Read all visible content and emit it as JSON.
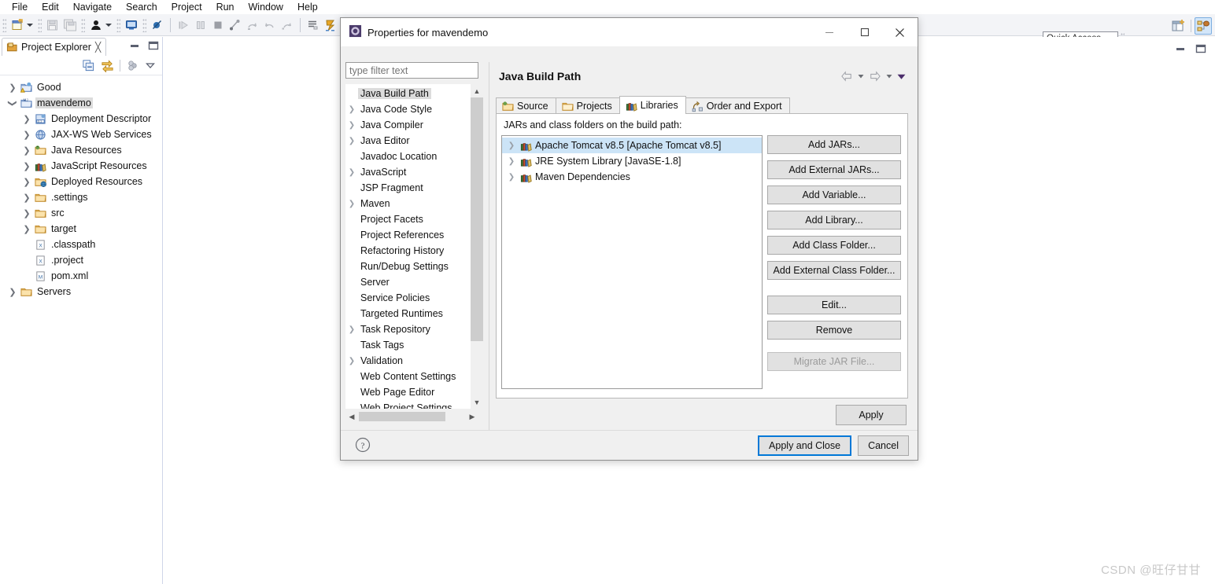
{
  "app": {
    "menubar": [
      "File",
      "Edit",
      "Navigate",
      "Search",
      "Project",
      "Run",
      "Window",
      "Help"
    ],
    "quick_access_placeholder": "Quick Access"
  },
  "explorer": {
    "tab_label": "Project Explorer",
    "tree": [
      {
        "label": "Good",
        "indent": 0,
        "twisty": "collapsed",
        "icon": "java-project-warning-icon",
        "selected": false
      },
      {
        "label": "mavendemo",
        "indent": 0,
        "twisty": "expanded",
        "icon": "maven-project-icon",
        "selected": true
      },
      {
        "label": "Deployment Descriptor",
        "indent": 1,
        "twisty": "collapsed",
        "icon": "deployment-descriptor-icon",
        "selected": false
      },
      {
        "label": "JAX-WS Web Services",
        "indent": 1,
        "twisty": "collapsed",
        "icon": "jaxws-icon",
        "selected": false
      },
      {
        "label": "Java Resources",
        "indent": 1,
        "twisty": "collapsed",
        "icon": "java-resources-icon",
        "selected": false
      },
      {
        "label": "JavaScript Resources",
        "indent": 1,
        "twisty": "collapsed",
        "icon": "library-icon",
        "selected": false
      },
      {
        "label": "Deployed Resources",
        "indent": 1,
        "twisty": "collapsed",
        "icon": "deployed-resources-icon",
        "selected": false
      },
      {
        "label": ".settings",
        "indent": 1,
        "twisty": "collapsed",
        "icon": "folder-icon",
        "selected": false
      },
      {
        "label": "src",
        "indent": 1,
        "twisty": "collapsed",
        "icon": "folder-icon",
        "selected": false
      },
      {
        "label": "target",
        "indent": 1,
        "twisty": "collapsed",
        "icon": "folder-icon",
        "selected": false
      },
      {
        "label": ".classpath",
        "indent": 1,
        "twisty": "none",
        "icon": "xml-file-icon",
        "selected": false
      },
      {
        "label": ".project",
        "indent": 1,
        "twisty": "none",
        "icon": "xml-file-icon",
        "selected": false
      },
      {
        "label": "pom.xml",
        "indent": 1,
        "twisty": "none",
        "icon": "maven-pom-icon",
        "selected": false
      },
      {
        "label": "Servers",
        "indent": 0,
        "twisty": "collapsed",
        "icon": "folder-icon",
        "selected": false
      }
    ]
  },
  "dialog": {
    "title": "Properties for mavendemo",
    "filter_placeholder": "type filter text",
    "filter_value": "",
    "nav_items": [
      {
        "label": "Java Build Path",
        "twisty": "none",
        "selected": true
      },
      {
        "label": "Java Code Style",
        "twisty": "collapsed",
        "selected": false
      },
      {
        "label": "Java Compiler",
        "twisty": "collapsed",
        "selected": false
      },
      {
        "label": "Java Editor",
        "twisty": "collapsed",
        "selected": false
      },
      {
        "label": "Javadoc Location",
        "twisty": "none",
        "selected": false
      },
      {
        "label": "JavaScript",
        "twisty": "collapsed",
        "selected": false
      },
      {
        "label": "JSP Fragment",
        "twisty": "none",
        "selected": false
      },
      {
        "label": "Maven",
        "twisty": "collapsed",
        "selected": false
      },
      {
        "label": "Project Facets",
        "twisty": "none",
        "selected": false
      },
      {
        "label": "Project References",
        "twisty": "none",
        "selected": false
      },
      {
        "label": "Refactoring History",
        "twisty": "none",
        "selected": false
      },
      {
        "label": "Run/Debug Settings",
        "twisty": "none",
        "selected": false
      },
      {
        "label": "Server",
        "twisty": "none",
        "selected": false
      },
      {
        "label": "Service Policies",
        "twisty": "none",
        "selected": false
      },
      {
        "label": "Targeted Runtimes",
        "twisty": "none",
        "selected": false
      },
      {
        "label": "Task Repository",
        "twisty": "collapsed",
        "selected": false
      },
      {
        "label": "Task Tags",
        "twisty": "none",
        "selected": false
      },
      {
        "label": "Validation",
        "twisty": "collapsed",
        "selected": false
      },
      {
        "label": "Web Content Settings",
        "twisty": "none",
        "selected": false
      },
      {
        "label": "Web Page Editor",
        "twisty": "none",
        "selected": false
      },
      {
        "label": "Web Project Settings",
        "twisty": "none",
        "selected": false
      }
    ],
    "page_title": "Java Build Path",
    "tabs": [
      {
        "label": "Source",
        "icon": "source-folder-icon",
        "active": false
      },
      {
        "label": "Projects",
        "icon": "projects-icon",
        "active": false
      },
      {
        "label": "Libraries",
        "icon": "libraries-icon",
        "active": true
      },
      {
        "label": "Order and Export",
        "icon": "order-export-icon",
        "active": false
      }
    ],
    "jars_label": "JARs and class folders on the build path:",
    "jars": [
      {
        "label": "Apache Tomcat v8.5 [Apache Tomcat v8.5]",
        "icon": "library-icon",
        "selected": true
      },
      {
        "label": "JRE System Library [JavaSE-1.8]",
        "icon": "library-icon",
        "selected": false
      },
      {
        "label": "Maven Dependencies",
        "icon": "library-icon",
        "selected": false
      }
    ],
    "side_buttons": [
      {
        "label": "Add JARs...",
        "disabled": false,
        "gap": ""
      },
      {
        "label": "Add External JARs...",
        "disabled": false,
        "gap": ""
      },
      {
        "label": "Add Variable...",
        "disabled": false,
        "gap": ""
      },
      {
        "label": "Add Library...",
        "disabled": false,
        "gap": ""
      },
      {
        "label": "Add Class Folder...",
        "disabled": false,
        "gap": ""
      },
      {
        "label": "Add External Class Folder...",
        "disabled": false,
        "gap": ""
      },
      {
        "label": "Edit...",
        "disabled": false,
        "gap": "gap-top"
      },
      {
        "label": "Remove",
        "disabled": false,
        "gap": ""
      },
      {
        "label": "Migrate JAR File...",
        "disabled": true,
        "gap": "gap-top2"
      }
    ],
    "apply_label": "Apply",
    "apply_and_close_label": "Apply and Close",
    "cancel_label": "Cancel"
  },
  "watermark": "CSDN @旺仔甘甘",
  "colors": {
    "selection_blue": "#cce4f7",
    "tree_selected_gray": "#dcdcdc",
    "default_button_border": "#0078d7",
    "dialog_bg": "#f0f0f0",
    "toolbar_bg": "#f3f4f7",
    "tab_active_bg": "#e2eaf6"
  }
}
